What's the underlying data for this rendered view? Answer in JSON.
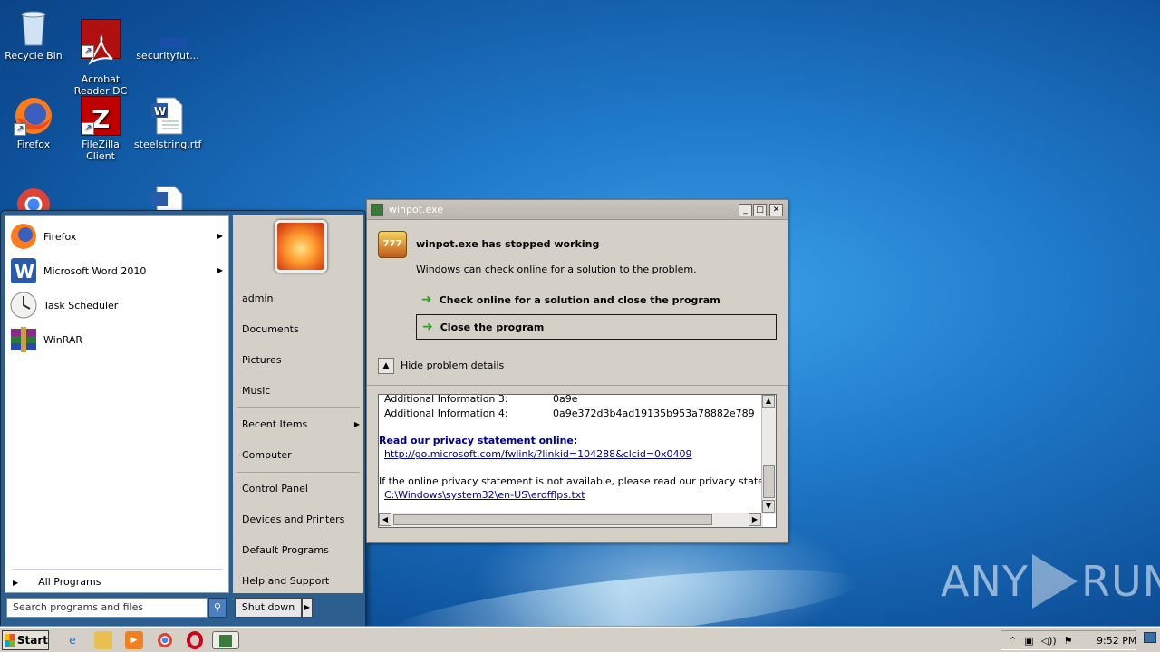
{
  "desktop": {
    "icons": [
      {
        "label": "Recycle Bin",
        "icon": "recycle-bin-icon"
      },
      {
        "label": "Acrobat\nReader DC",
        "icon": "acrobat-icon"
      },
      {
        "label": "securityfut...",
        "icon": "file-icon"
      },
      {
        "label": "Firefox",
        "icon": "firefox-icon"
      },
      {
        "label": "FileZilla Client",
        "icon": "filezilla-icon"
      },
      {
        "label": "steelstring.rtf",
        "icon": "word-doc-icon"
      }
    ]
  },
  "start_menu": {
    "programs": [
      {
        "label": "Firefox",
        "has_submenu": true
      },
      {
        "label": "Microsoft Word 2010",
        "has_submenu": true
      },
      {
        "label": "Task Scheduler",
        "has_submenu": false
      },
      {
        "label": "WinRAR",
        "has_submenu": false
      }
    ],
    "all_programs": "All Programs",
    "search_placeholder": "Search programs and files",
    "right_links": [
      "admin",
      "Documents",
      "Pictures",
      "Music",
      "Recent Items",
      "Computer",
      "Control Panel",
      "Devices and Printers",
      "Default Programs",
      "Help and Support"
    ],
    "shutdown": "Shut down"
  },
  "dialog": {
    "title": "winpot.exe",
    "header": "winpot.exe has stopped working",
    "subtitle": "Windows can check online for a solution to the problem.",
    "option_check": "Check online for a solution and close the program",
    "option_close": "Close the program",
    "toggle_details": "Hide problem details",
    "details": {
      "info3_label": "Additional Information 3:",
      "info3_value": "0a9e",
      "info4_label": "Additional Information 4:",
      "info4_value": "0a9e372d3b4ad19135b953a78882e789",
      "privacy_heading": "Read our privacy statement online:",
      "privacy_link": "http://go.microsoft.com/fwlink/?linkid=104288&clcid=0x0409",
      "offline_text": "If the online privacy statement is not available, please read our privacy statement offline:",
      "offline_link": "C:\\Windows\\system32\\en-US\\erofflps.txt"
    }
  },
  "taskbar": {
    "start_label": "Start",
    "clock": "9:52 PM"
  },
  "watermark": {
    "left": "ANY",
    "right": "RUN"
  },
  "colors": {
    "desktop": "#1f79c9",
    "start_menu_frame": "#2c5f8f",
    "link": "#00008b"
  }
}
